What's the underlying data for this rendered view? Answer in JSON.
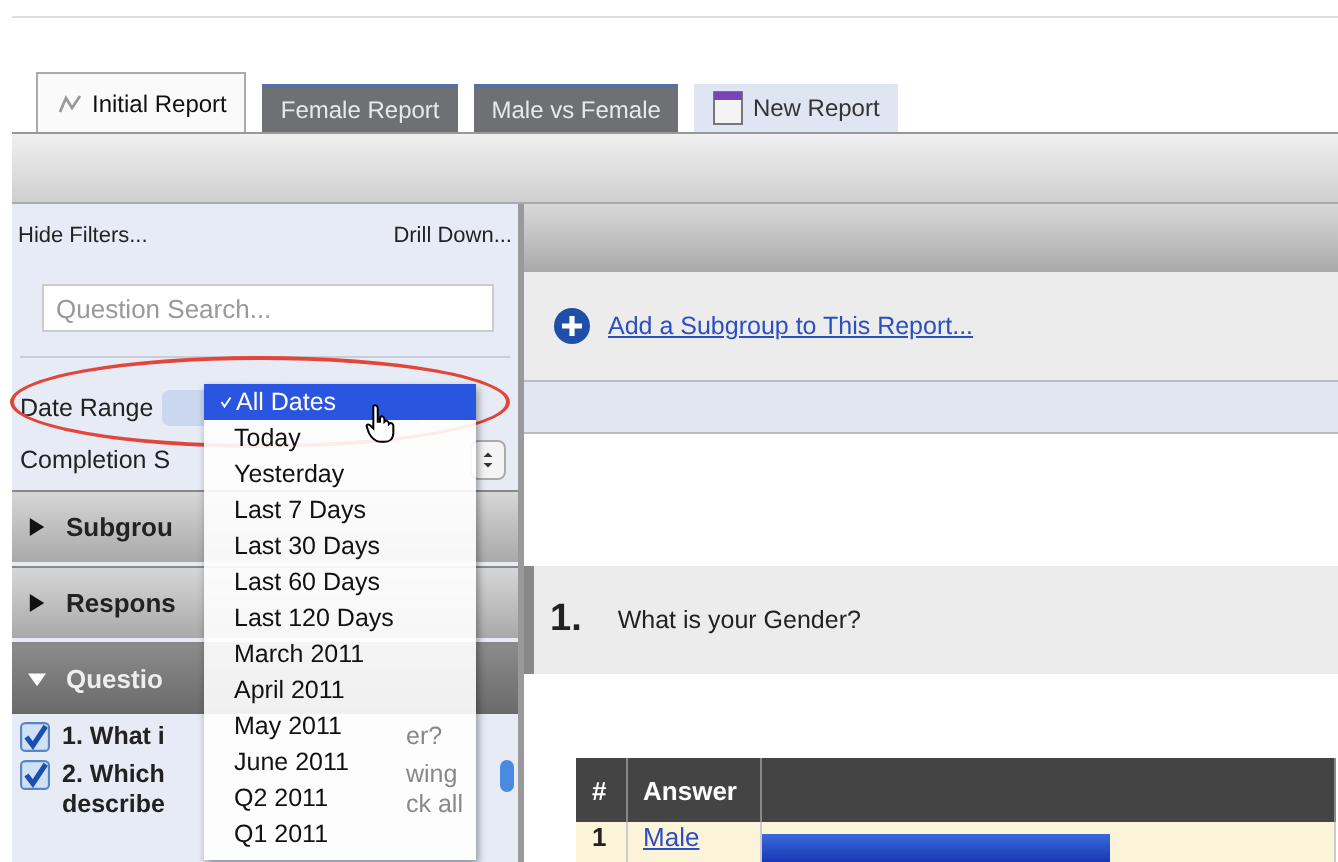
{
  "tabs": [
    {
      "label": "Initial Report",
      "kind": "current",
      "selected": true
    },
    {
      "label": "Female Report",
      "kind": "report",
      "selected": false
    },
    {
      "label": "Male vs Female",
      "kind": "report",
      "selected": false
    },
    {
      "label": "New Report",
      "kind": "new",
      "selected": false
    }
  ],
  "sidebar": {
    "hide_filters": "Hide Filters...",
    "drill_down": "Drill Down...",
    "search": {
      "placeholder": "Question Search..."
    },
    "date_range_label": "Date Range",
    "completion_label": "Completion S",
    "sections": [
      {
        "label": "Subgrou",
        "expanded": false
      },
      {
        "label": "Respons",
        "expanded": false
      },
      {
        "label": "Questio",
        "expanded": true
      }
    ],
    "questions": [
      {
        "lines": [
          {
            "left": "1. What i",
            "right": "er?"
          }
        ],
        "checked": true
      },
      {
        "lines": [
          {
            "left": "2. Which",
            "right": "wing"
          },
          {
            "left": "describe",
            "right": "ck all"
          }
        ],
        "checked": true
      }
    ]
  },
  "date_dropdown": {
    "options": [
      {
        "label": "All Dates",
        "selected": true
      },
      {
        "label": "Today",
        "selected": false
      },
      {
        "label": "Yesterday",
        "selected": false
      },
      {
        "label": "Last 7 Days",
        "selected": false
      },
      {
        "label": "Last 30 Days",
        "selected": false
      },
      {
        "label": "Last 60 Days",
        "selected": false
      },
      {
        "label": "Last 120 Days",
        "selected": false
      },
      {
        "label": "March 2011",
        "selected": false
      },
      {
        "label": "April 2011",
        "selected": false
      },
      {
        "label": "May 2011",
        "selected": false
      },
      {
        "label": "June 2011",
        "selected": false
      },
      {
        "label": "Q2 2011",
        "selected": false
      },
      {
        "label": "Q1 2011",
        "selected": false
      }
    ]
  },
  "content": {
    "add_subgroup": "Add a Subgroup to This Report...",
    "question_number": "1.",
    "question_text": "What is your Gender?",
    "table": {
      "columns": [
        "#",
        "Answer"
      ],
      "rows": [
        {
          "number": "1",
          "answer": "Male",
          "level": 0.61
        }
      ]
    }
  }
}
